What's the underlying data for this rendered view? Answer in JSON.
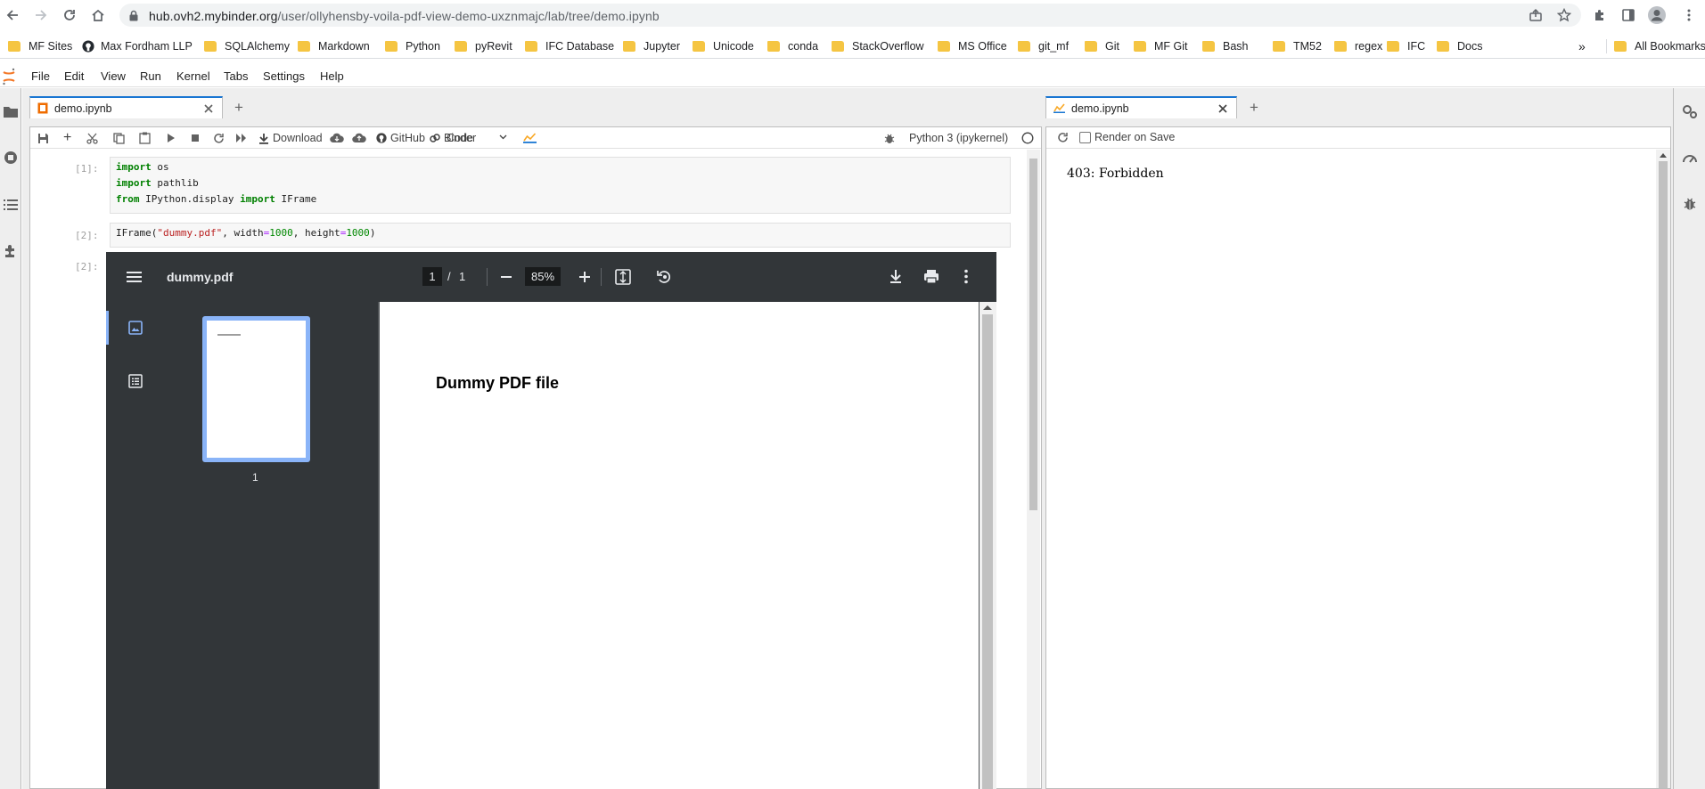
{
  "browser": {
    "url_host": "hub.ovh2.mybinder.org",
    "url_path": "/user/ollyhensby-voila-pdf-view-demo-uxznmajc/lab/tree/demo.ipynb",
    "bookmarks": [
      "MF Sites",
      "Max Fordham LLP",
      "SQLAlchemy",
      "Markdown",
      "Python",
      "pyRevit",
      "IFC Database",
      "Jupyter",
      "Unicode",
      "conda",
      "StackOverflow",
      "MS Office",
      "git_mf",
      "Git",
      "MF Git",
      "Bash",
      "TM52",
      "regex",
      "IFC",
      "Docs"
    ],
    "more_bookmarks": "»",
    "all_bookmarks": "All Bookmarks"
  },
  "menubar": {
    "items": [
      "File",
      "Edit",
      "View",
      "Run",
      "Kernel",
      "Tabs",
      "Settings",
      "Help"
    ]
  },
  "notebook": {
    "tab_label": "demo.ipynb",
    "toolbar": {
      "download_label": "Download",
      "github_label": "GitHub",
      "binder_label": "Binder",
      "cell_type": "Code",
      "kernel_name": "Python 3 (ipykernel)"
    },
    "cells": [
      {
        "prompt": "[1]:",
        "lines": [
          {
            "kw": "import",
            "rest": " os"
          },
          {
            "kw": "import",
            "rest": " pathlib"
          },
          {
            "kw": "from",
            "mid": " IPython.display ",
            "kw2": "import",
            "rest": " IFrame"
          }
        ]
      },
      {
        "prompt": "[2]:",
        "code_func": "IFrame(",
        "code_str": "\"dummy.pdf\"",
        "code_mid1": ", width",
        "code_eq1": "=",
        "code_num1": "1000",
        "code_mid2": ", height",
        "code_eq2": "=",
        "code_num2": "1000",
        "code_end": ")"
      }
    ],
    "output_prompt": "[2]:"
  },
  "pdf_viewer": {
    "file_name": "dummy.pdf",
    "current_page": "1",
    "page_sep": "/",
    "total_pages": "1",
    "zoom": "85%",
    "thumbnail_label": "1",
    "page_heading": "Dummy PDF file"
  },
  "preview": {
    "tab_label": "demo.ipynb",
    "render_on_save_label": "Render on Save",
    "render_on_save_checked": false,
    "message": "403: Forbidden"
  },
  "colors": {
    "accent": "#1976d2",
    "pdf_dark": "#323639",
    "thumb_border": "#8ab4f8"
  }
}
